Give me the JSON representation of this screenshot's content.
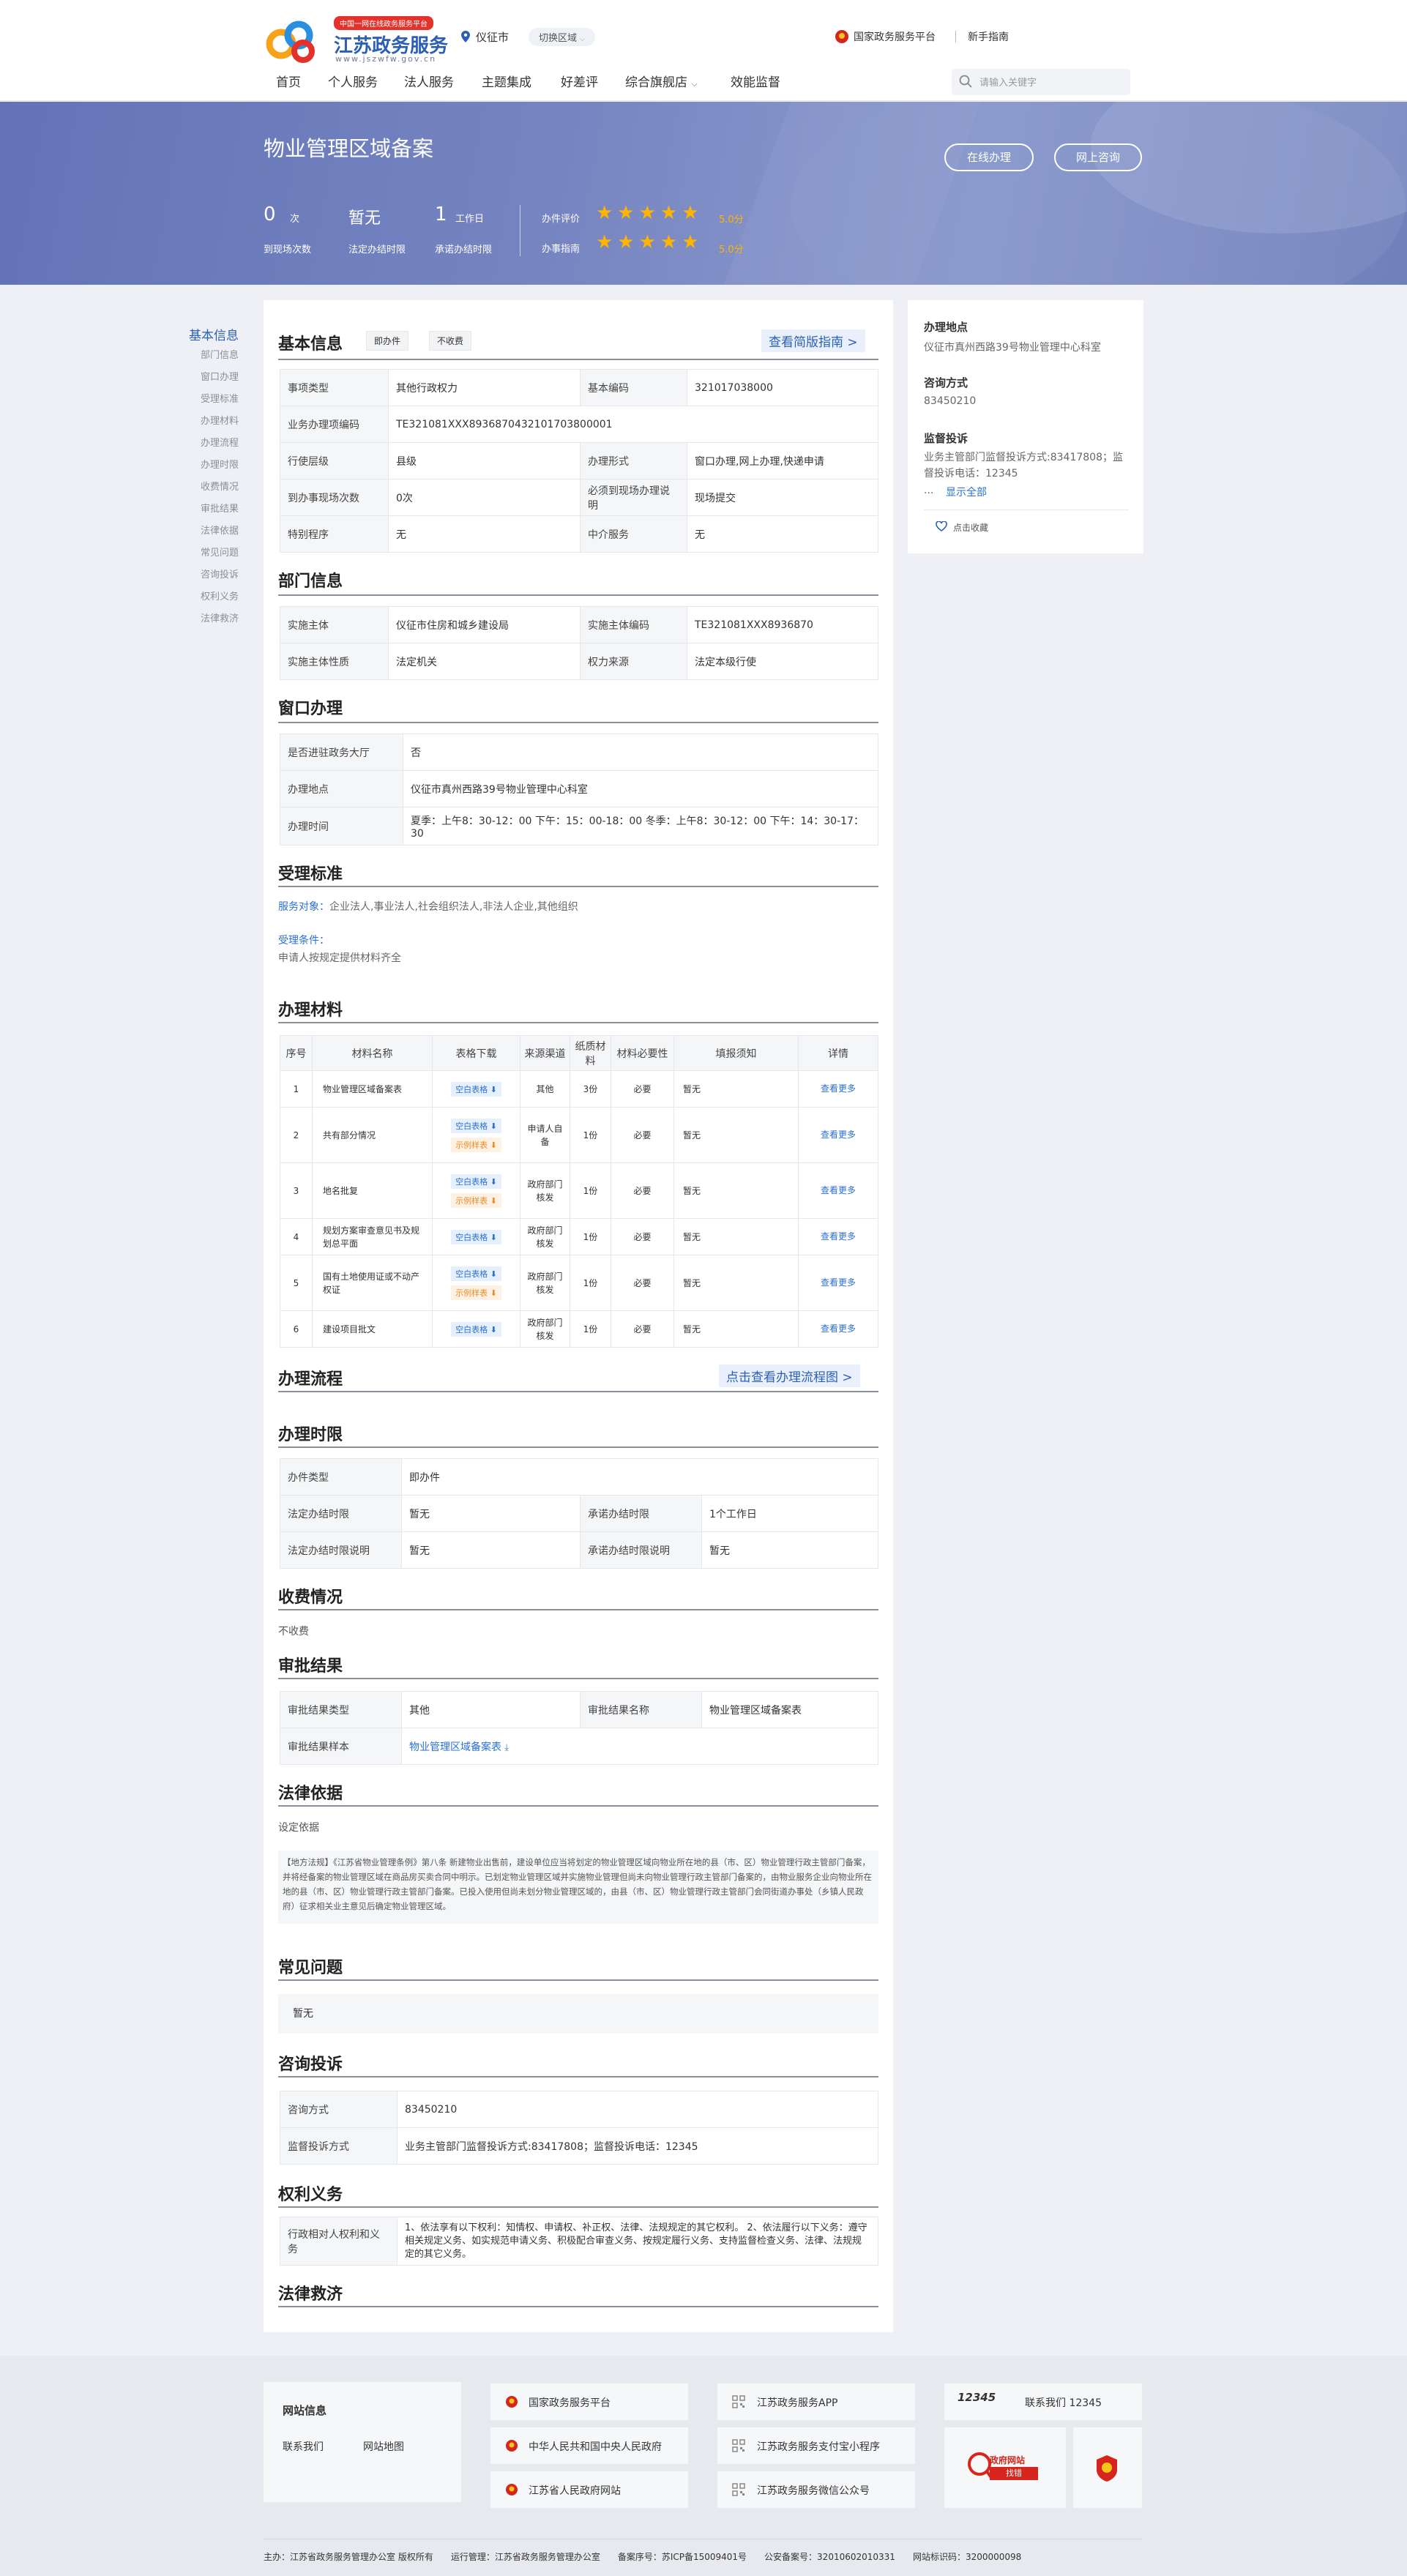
{
  "header": {
    "logo_badge": "中国一网在线政务服务平台",
    "logo_title": "江苏政务服务",
    "logo_sub": "www.jszwfw.gov.cn",
    "location": "仪征市",
    "switch_region": "切换区域",
    "national_platform": "国家政务服务平台",
    "guide": "新手指南",
    "nav": [
      "首页",
      "个人服务",
      "法人服务",
      "主题集成",
      "好差评",
      "综合旗舰店",
      "效能监督"
    ],
    "search_placeholder": "请输入关键字"
  },
  "banner": {
    "title": "物业管理区域备案",
    "btn_online": "在线办理",
    "btn_consult": "网上咨询",
    "stats": [
      {
        "value": "0",
        "unit": "次",
        "label": "到现场次数"
      },
      {
        "value": "暂无",
        "unit": "",
        "label": "法定办结时限"
      },
      {
        "value": "1",
        "unit": "工作日",
        "label": "承诺办结时限"
      }
    ],
    "ratings": [
      {
        "label": "办件评价",
        "stars": 5,
        "score": "5.0分"
      },
      {
        "label": "办事指南",
        "stars": 5,
        "score": "5.0分"
      }
    ]
  },
  "left_nav": [
    "基本信息",
    "部门信息",
    "窗口办理",
    "受理标准",
    "办理材料",
    "办理流程",
    "办理时限",
    "收费情况",
    "审批结果",
    "法律依据",
    "常见问题",
    "咨询投诉",
    "权利义务",
    "法律救济"
  ],
  "basic": {
    "title": "基本信息",
    "tags": [
      "即办件",
      "不收费"
    ],
    "brief_link": "查看简版指南 >",
    "rows": [
      [
        "事项类型",
        "其他行政权力",
        "基本编码",
        "321017038000"
      ],
      [
        "业务办理项编码",
        "TE321081XXX8936870432101703800001"
      ],
      [
        "行使层级",
        "县级",
        "办理形式",
        "窗口办理,网上办理,快递申请"
      ],
      [
        "到办事现场次数",
        "0次",
        "必须到现场办理说明",
        "现场提交"
      ],
      [
        "特别程序",
        "无",
        "中介服务",
        "无"
      ]
    ]
  },
  "dept": {
    "title": "部门信息",
    "rows": [
      [
        "实施主体",
        "仪征市住房和城乡建设局",
        "实施主体编码",
        "TE321081XXX8936870"
      ],
      [
        "实施主体性质",
        "法定机关",
        "权力来源",
        "法定本级行使"
      ]
    ]
  },
  "window": {
    "title": "窗口办理",
    "rows": [
      [
        "是否进驻政务大厅",
        "否"
      ],
      [
        "办理地点",
        "仪征市真州西路39号物业管理中心科室"
      ],
      [
        "办理时间",
        "夏季：上午8：30-12：00 下午：15：00-18：00 冬季：上午8：30-12：00 下午：14：30-17：30"
      ]
    ]
  },
  "accept": {
    "title": "受理标准",
    "target_label": "服务对象：",
    "target_value": "企业法人,事业法人,社会组织法人,非法人企业,其他组织",
    "cond_label": "受理条件：",
    "cond_value": "申请人按规定提供材料齐全"
  },
  "materials": {
    "title": "办理材料",
    "headers": [
      "序号",
      "材料名称",
      "表格下载",
      "来源渠道",
      "纸质材料",
      "材料必要性",
      "填报须知",
      "详情"
    ],
    "blank_label": "空白表格",
    "sample_label": "示例样表",
    "more_label": "查看更多",
    "rows": [
      {
        "no": "1",
        "name": "物业管理区域备案表",
        "sample": false,
        "source": "其他",
        "paper": "3份",
        "need": "必要",
        "note": "暂无"
      },
      {
        "no": "2",
        "name": "共有部分情况",
        "sample": true,
        "source": "申请人自备",
        "paper": "1份",
        "need": "必要",
        "note": "暂无"
      },
      {
        "no": "3",
        "name": "地名批复",
        "sample": true,
        "source": "政府部门核发",
        "paper": "1份",
        "need": "必要",
        "note": "暂无"
      },
      {
        "no": "4",
        "name": "规划方案审查意见书及规划总平面",
        "sample": false,
        "source": "政府部门核发",
        "paper": "1份",
        "need": "必要",
        "note": "暂无"
      },
      {
        "no": "5",
        "name": "国有土地使用证或不动产权证",
        "sample": true,
        "source": "政府部门核发",
        "paper": "1份",
        "need": "必要",
        "note": "暂无"
      },
      {
        "no": "6",
        "name": "建设项目批文",
        "sample": false,
        "source": "政府部门核发",
        "paper": "1份",
        "need": "必要",
        "note": "暂无"
      }
    ]
  },
  "process": {
    "title": "办理流程",
    "link": "点击查看办理流程图 >"
  },
  "limit": {
    "title": "办理时限",
    "type_label": "办件类型",
    "type_value": "即办件",
    "rows": [
      [
        "法定办结时限",
        "暂无",
        "承诺办结时限",
        "1个工作日"
      ],
      [
        "法定办结时限说明",
        "暂无",
        "承诺办结时限说明",
        "暂无"
      ]
    ]
  },
  "fee": {
    "title": "收费情况",
    "value": "不收费"
  },
  "result": {
    "title": "审批结果",
    "rows": [
      [
        "审批结果类型",
        "其他",
        "审批结果名称",
        "物业管理区域备案表"
      ]
    ],
    "sample_label": "审批结果样本",
    "sample_link": "物业管理区域备案表"
  },
  "law": {
    "title": "法律依据",
    "sub": "设定依据",
    "text": "【地方法规】《江苏省物业管理条例》第八条 新建物业出售前，建设单位应当将划定的物业管理区域向物业所在地的县（市、区）物业管理行政主管部门备案，并将经备案的物业管理区域在商品房买卖合同中明示。已划定物业管理区域并实施物业管理但尚未向物业管理行政主管部门备案的，由物业服务企业向物业所在地的县（市、区）物业管理行政主管部门备案。已投入使用但尚未划分物业管理区域的，由县（市、区）物业管理行政主管部门会同街道办事处（乡镇人民政府）征求相关业主意见后确定物业管理区域。"
  },
  "faq": {
    "title": "常见问题",
    "value": "暂无"
  },
  "consult": {
    "title": "咨询投诉",
    "rows": [
      [
        "咨询方式",
        "83450210"
      ],
      [
        "监督投诉方式",
        "业务主管部门监督投诉方式:83417808；监督投诉电话：12345"
      ]
    ]
  },
  "rights": {
    "title": "权利义务",
    "label": "行政相对人权利和义务",
    "value": "1、依法享有以下权利：知情权、申请权、补正权、法律、法规规定的其它权利。 2、依法履行以下义务：遵守相关规定义务、如实规范申请义务、积极配合审查义务、按规定履行义务、支持监督检查义务、法律、法规规定的其它义务。"
  },
  "remedy": {
    "title": "法律救济"
  },
  "side": {
    "place_title": "办理地点",
    "place_value": "仪征市真州西路39号物业管理中心科室",
    "consult_title": "咨询方式",
    "consult_value": "83450210",
    "supervise_title": "监督投诉",
    "supervise_value": "业务主管部门监督投诉方式:83417808；监督投诉电话：12345",
    "ellipsis": "...",
    "show_all": "显示全部",
    "collect": "点击收藏"
  },
  "footer": {
    "info_title": "网站信息",
    "contact": "联系我们",
    "sitemap": "网站地图",
    "links": [
      "国家政务服务平台",
      "中华人民共和国中央人民政府",
      "江苏省人民政府网站",
      "江苏政务服务APP",
      "江苏政务服务支付宝小程序",
      "江苏政务服务微信公众号"
    ],
    "hotline_logo": "12345",
    "hotline": "联系我们 12345",
    "errata_title": "政府网站",
    "errata_sub": "找错",
    "copyright": "主办：江苏省政务服务管理办公室 版权所有　　运行管理：江苏省政务服务管理办公室　　备案序号：苏ICP备15009401号　　公安备案号：32010602010331　　网站标识码：3200000098"
  },
  "colors": {
    "brand": "#2b5fb5",
    "star": "#ffb400",
    "badge": "#e3322c"
  }
}
